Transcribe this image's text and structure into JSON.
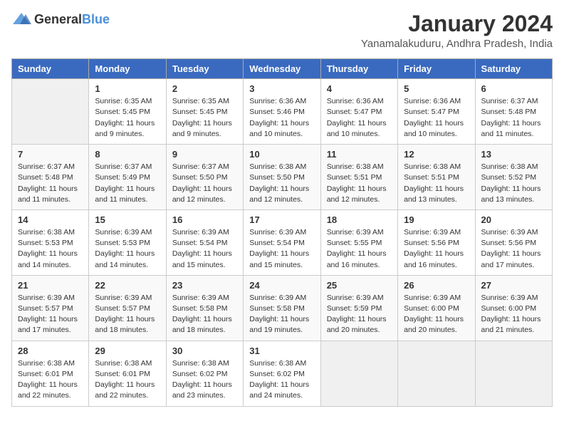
{
  "header": {
    "logo": {
      "general": "General",
      "blue": "Blue"
    },
    "title": "January 2024",
    "subtitle": "Yanamalakuduru, Andhra Pradesh, India"
  },
  "calendar": {
    "days_of_week": [
      "Sunday",
      "Monday",
      "Tuesday",
      "Wednesday",
      "Thursday",
      "Friday",
      "Saturday"
    ],
    "weeks": [
      [
        {
          "day": "",
          "info": ""
        },
        {
          "day": "1",
          "info": "Sunrise: 6:35 AM\nSunset: 5:45 PM\nDaylight: 11 hours and 9 minutes."
        },
        {
          "day": "2",
          "info": "Sunrise: 6:35 AM\nSunset: 5:45 PM\nDaylight: 11 hours and 9 minutes."
        },
        {
          "day": "3",
          "info": "Sunrise: 6:36 AM\nSunset: 5:46 PM\nDaylight: 11 hours and 10 minutes."
        },
        {
          "day": "4",
          "info": "Sunrise: 6:36 AM\nSunset: 5:47 PM\nDaylight: 11 hours and 10 minutes."
        },
        {
          "day": "5",
          "info": "Sunrise: 6:36 AM\nSunset: 5:47 PM\nDaylight: 11 hours and 10 minutes."
        },
        {
          "day": "6",
          "info": "Sunrise: 6:37 AM\nSunset: 5:48 PM\nDaylight: 11 hours and 11 minutes."
        }
      ],
      [
        {
          "day": "7",
          "info": "Sunrise: 6:37 AM\nSunset: 5:48 PM\nDaylight: 11 hours and 11 minutes."
        },
        {
          "day": "8",
          "info": "Sunrise: 6:37 AM\nSunset: 5:49 PM\nDaylight: 11 hours and 11 minutes."
        },
        {
          "day": "9",
          "info": "Sunrise: 6:37 AM\nSunset: 5:50 PM\nDaylight: 11 hours and 12 minutes."
        },
        {
          "day": "10",
          "info": "Sunrise: 6:38 AM\nSunset: 5:50 PM\nDaylight: 11 hours and 12 minutes."
        },
        {
          "day": "11",
          "info": "Sunrise: 6:38 AM\nSunset: 5:51 PM\nDaylight: 11 hours and 12 minutes."
        },
        {
          "day": "12",
          "info": "Sunrise: 6:38 AM\nSunset: 5:51 PM\nDaylight: 11 hours and 13 minutes."
        },
        {
          "day": "13",
          "info": "Sunrise: 6:38 AM\nSunset: 5:52 PM\nDaylight: 11 hours and 13 minutes."
        }
      ],
      [
        {
          "day": "14",
          "info": "Sunrise: 6:38 AM\nSunset: 5:53 PM\nDaylight: 11 hours and 14 minutes."
        },
        {
          "day": "15",
          "info": "Sunrise: 6:39 AM\nSunset: 5:53 PM\nDaylight: 11 hours and 14 minutes."
        },
        {
          "day": "16",
          "info": "Sunrise: 6:39 AM\nSunset: 5:54 PM\nDaylight: 11 hours and 15 minutes."
        },
        {
          "day": "17",
          "info": "Sunrise: 6:39 AM\nSunset: 5:54 PM\nDaylight: 11 hours and 15 minutes."
        },
        {
          "day": "18",
          "info": "Sunrise: 6:39 AM\nSunset: 5:55 PM\nDaylight: 11 hours and 16 minutes."
        },
        {
          "day": "19",
          "info": "Sunrise: 6:39 AM\nSunset: 5:56 PM\nDaylight: 11 hours and 16 minutes."
        },
        {
          "day": "20",
          "info": "Sunrise: 6:39 AM\nSunset: 5:56 PM\nDaylight: 11 hours and 17 minutes."
        }
      ],
      [
        {
          "day": "21",
          "info": "Sunrise: 6:39 AM\nSunset: 5:57 PM\nDaylight: 11 hours and 17 minutes."
        },
        {
          "day": "22",
          "info": "Sunrise: 6:39 AM\nSunset: 5:57 PM\nDaylight: 11 hours and 18 minutes."
        },
        {
          "day": "23",
          "info": "Sunrise: 6:39 AM\nSunset: 5:58 PM\nDaylight: 11 hours and 18 minutes."
        },
        {
          "day": "24",
          "info": "Sunrise: 6:39 AM\nSunset: 5:58 PM\nDaylight: 11 hours and 19 minutes."
        },
        {
          "day": "25",
          "info": "Sunrise: 6:39 AM\nSunset: 5:59 PM\nDaylight: 11 hours and 20 minutes."
        },
        {
          "day": "26",
          "info": "Sunrise: 6:39 AM\nSunset: 6:00 PM\nDaylight: 11 hours and 20 minutes."
        },
        {
          "day": "27",
          "info": "Sunrise: 6:39 AM\nSunset: 6:00 PM\nDaylight: 11 hours and 21 minutes."
        }
      ],
      [
        {
          "day": "28",
          "info": "Sunrise: 6:38 AM\nSunset: 6:01 PM\nDaylight: 11 hours and 22 minutes."
        },
        {
          "day": "29",
          "info": "Sunrise: 6:38 AM\nSunset: 6:01 PM\nDaylight: 11 hours and 22 minutes."
        },
        {
          "day": "30",
          "info": "Sunrise: 6:38 AM\nSunset: 6:02 PM\nDaylight: 11 hours and 23 minutes."
        },
        {
          "day": "31",
          "info": "Sunrise: 6:38 AM\nSunset: 6:02 PM\nDaylight: 11 hours and 24 minutes."
        },
        {
          "day": "",
          "info": ""
        },
        {
          "day": "",
          "info": ""
        },
        {
          "day": "",
          "info": ""
        }
      ]
    ]
  }
}
